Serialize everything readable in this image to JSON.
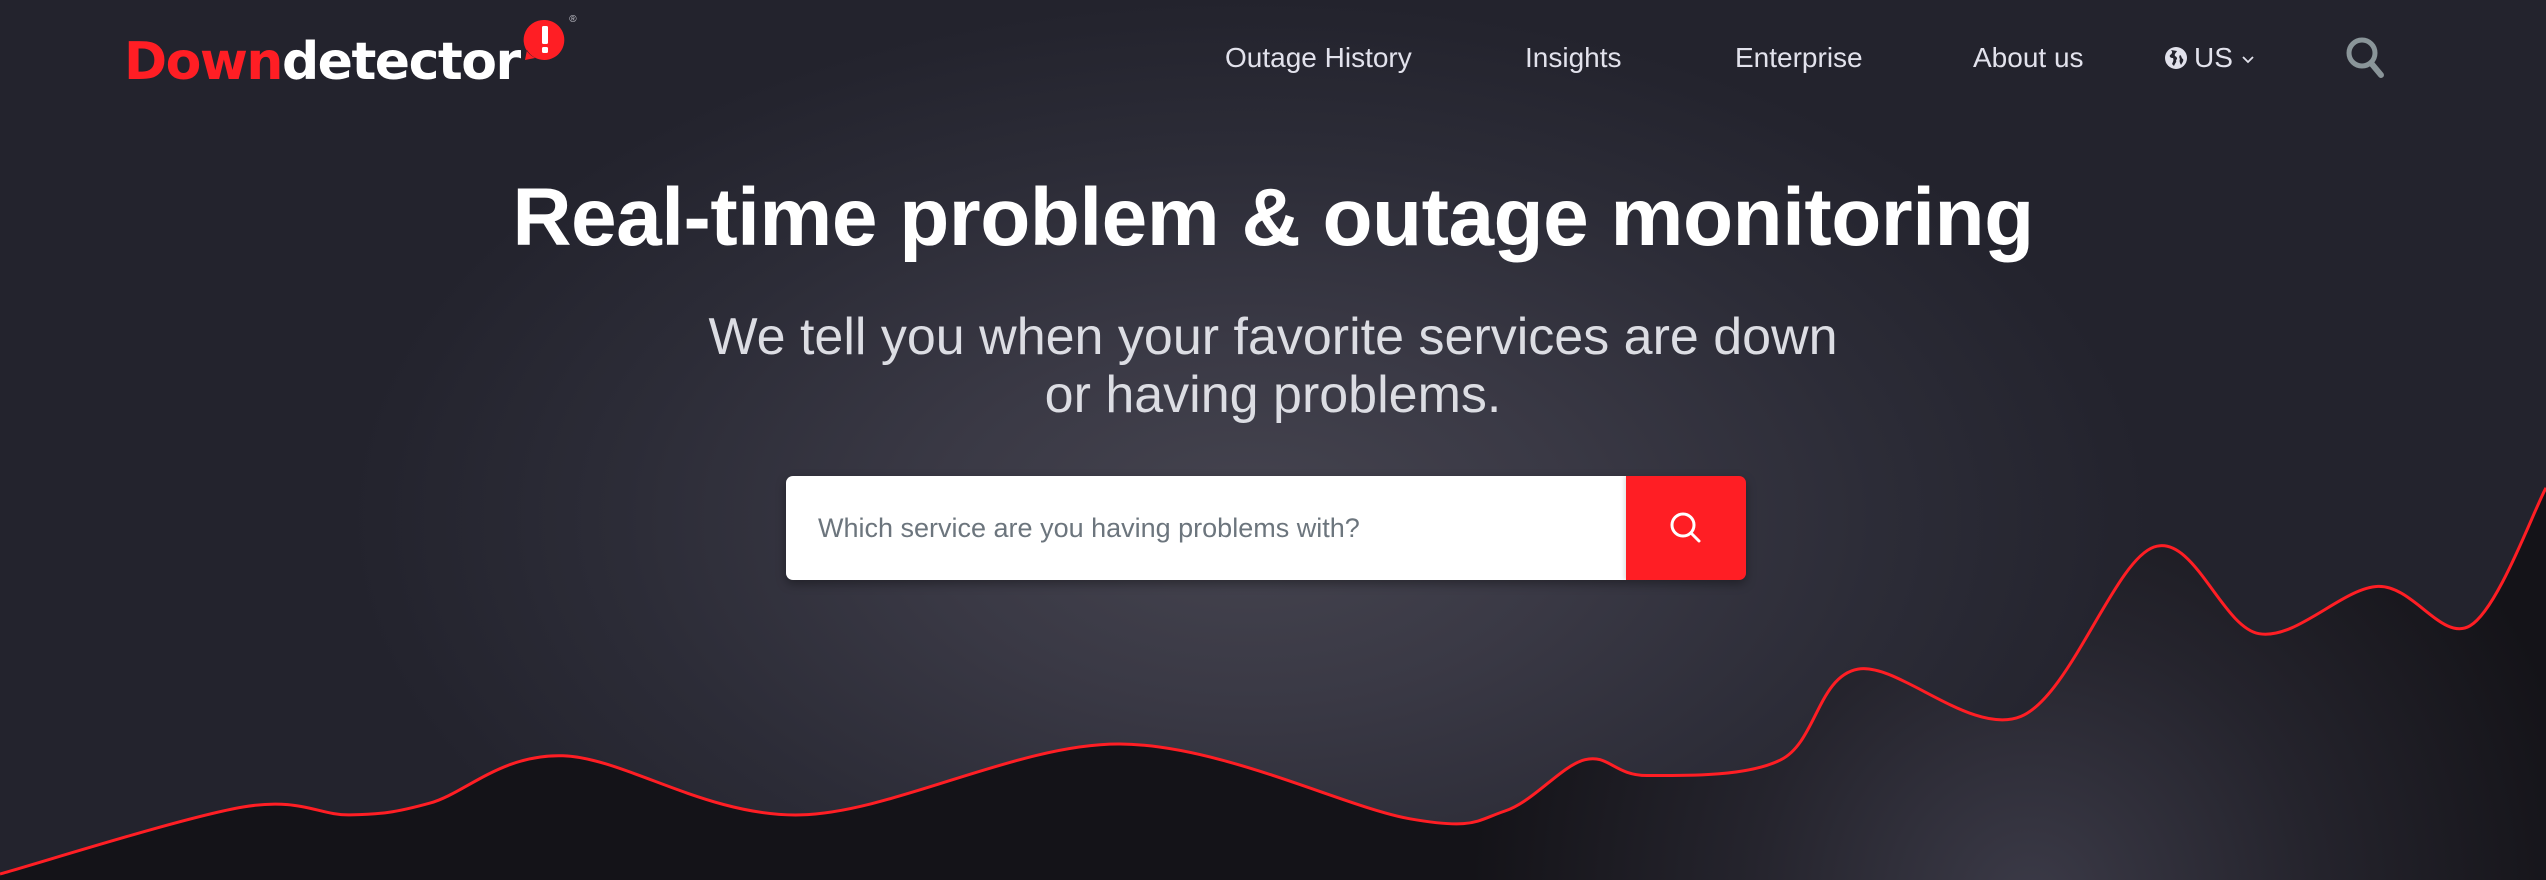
{
  "brand": {
    "name_part_red": "Down",
    "name_part_white": "detector",
    "badge_glyph": "!",
    "registered_mark": "®",
    "colors": {
      "accent_red": "#ff1e24",
      "background_dark": "#23232d",
      "background_center": "#41404d",
      "wave_fill": "#141318",
      "nav_text": "#e2e2ec",
      "subtitle_text": "#dcdde3",
      "placeholder_text": "#6c757d",
      "search_icon_grey": "#8a9599"
    }
  },
  "nav": {
    "items": [
      {
        "label": "Outage History"
      },
      {
        "label": "Insights"
      },
      {
        "label": "Enterprise"
      },
      {
        "label": "About us"
      }
    ],
    "locale": {
      "label": "US",
      "icon": "globe-icon",
      "dropdown_icon": "chevron-down-icon"
    },
    "search_icon": "search-icon"
  },
  "hero": {
    "headline": "Real-time problem & outage monitoring",
    "subtitle_line1": "We tell you when your favorite services are down",
    "subtitle_line2": "or having problems.",
    "search": {
      "placeholder": "Which service are you having problems with?",
      "value": "",
      "button_icon": "search-icon"
    }
  },
  "decoration": {
    "outage_wave": {
      "description": "stylized outage-report trend line (illustrative, no axes)",
      "relative_levels": [
        0.0,
        0.17,
        0.15,
        0.18,
        0.3,
        0.15,
        0.33,
        0.14,
        0.16,
        0.29,
        0.25,
        0.29,
        0.52,
        0.4,
        0.83,
        0.61,
        0.73,
        0.63,
        0.98
      ]
    }
  }
}
